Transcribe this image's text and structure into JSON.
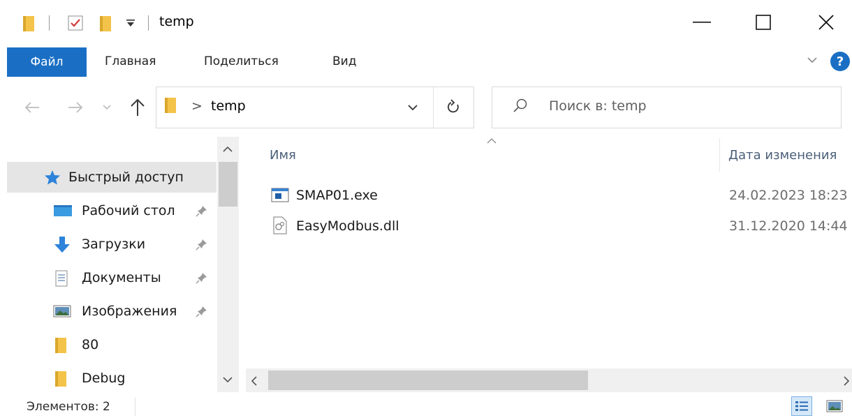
{
  "window": {
    "title": "temp",
    "minimize_glyph": "—",
    "maximize_glyph": "☐",
    "close_glyph": "✕"
  },
  "quick_access_toolbar": {
    "icons": [
      "folder-icon",
      "properties-icon",
      "new-folder-icon",
      "customize-dropdown-icon"
    ]
  },
  "ribbon": {
    "tabs": [
      {
        "label": "Файл",
        "active": true
      },
      {
        "label": "Главная"
      },
      {
        "label": "Поделиться"
      },
      {
        "label": "Вид"
      }
    ],
    "help_glyph": "?"
  },
  "address_bar": {
    "path_separator": ">",
    "current": "temp"
  },
  "search": {
    "placeholder": "Поиск в: temp"
  },
  "navigation_pane": {
    "items": [
      {
        "label": "Быстрый доступ",
        "icon": "star-icon",
        "selected": true,
        "pinned": false
      },
      {
        "label": "Рабочий стол",
        "icon": "desktop-icon",
        "pinned": true
      },
      {
        "label": "Загрузки",
        "icon": "downloads-icon",
        "pinned": true
      },
      {
        "label": "Документы",
        "icon": "documents-icon",
        "pinned": true
      },
      {
        "label": "Изображения",
        "icon": "pictures-icon",
        "pinned": true
      },
      {
        "label": "80",
        "icon": "folder-icon",
        "pinned": false
      },
      {
        "label": "Debug",
        "icon": "folder-icon",
        "pinned": false
      }
    ]
  },
  "file_list": {
    "columns": [
      {
        "label": "Имя"
      },
      {
        "label": "Дата изменения"
      }
    ],
    "rows": [
      {
        "name": "SMAP01.exe",
        "date": "24.02.2023 18:23",
        "icon": "exe-icon"
      },
      {
        "name": "EasyModbus.dll",
        "date": "31.12.2020 14:44",
        "icon": "dll-icon"
      }
    ]
  },
  "status_bar": {
    "items_count": "Элементов: 2"
  },
  "colors": {
    "accent": "#1a6fc4",
    "folder": "#f3c34a",
    "selection": "#e5e5e5"
  }
}
